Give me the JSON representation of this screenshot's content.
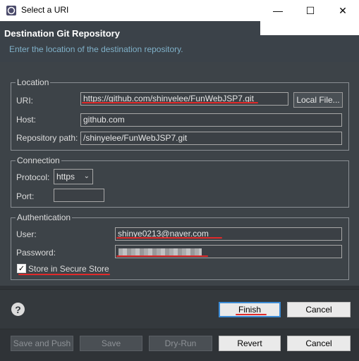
{
  "window": {
    "title": "Select a URI",
    "minimize": "—",
    "maximize": "☐",
    "close": "✕"
  },
  "header": {
    "title": "Destination Git Repository",
    "description": "Enter the location of the destination repository."
  },
  "location": {
    "legend": "Location",
    "uri_label": "URI:",
    "uri_value": "https://github.com/shinyelee/FunWebJSP7.git",
    "local_file_label": "Local File...",
    "host_label": "Host:",
    "host_value": "github.com",
    "repo_path_label": "Repository path:",
    "repo_path_value": "/shinyelee/FunWebJSP7.git"
  },
  "connection": {
    "legend": "Connection",
    "protocol_label": "Protocol:",
    "protocol_value": "https",
    "port_label": "Port:",
    "port_value": ""
  },
  "authentication": {
    "legend": "Authentication",
    "user_label": "User:",
    "user_value": "shinye0213@naver.com",
    "password_label": "Password:",
    "store_label": "Store in Secure Store",
    "store_checked": true
  },
  "footer": {
    "help_icon": "?",
    "finish_label": "Finish",
    "cancel_label": "Cancel"
  },
  "bottom_bar": {
    "save_and_push_label": "Save and Push",
    "save_label": "Save",
    "dry_run_label": "Dry-Run",
    "revert_label": "Revert",
    "cancel_label": "Cancel"
  },
  "colors": {
    "annotation_red": "#e12a2a",
    "focus_blue": "#3c8cd6",
    "header_desc": "#7fb0c8"
  }
}
